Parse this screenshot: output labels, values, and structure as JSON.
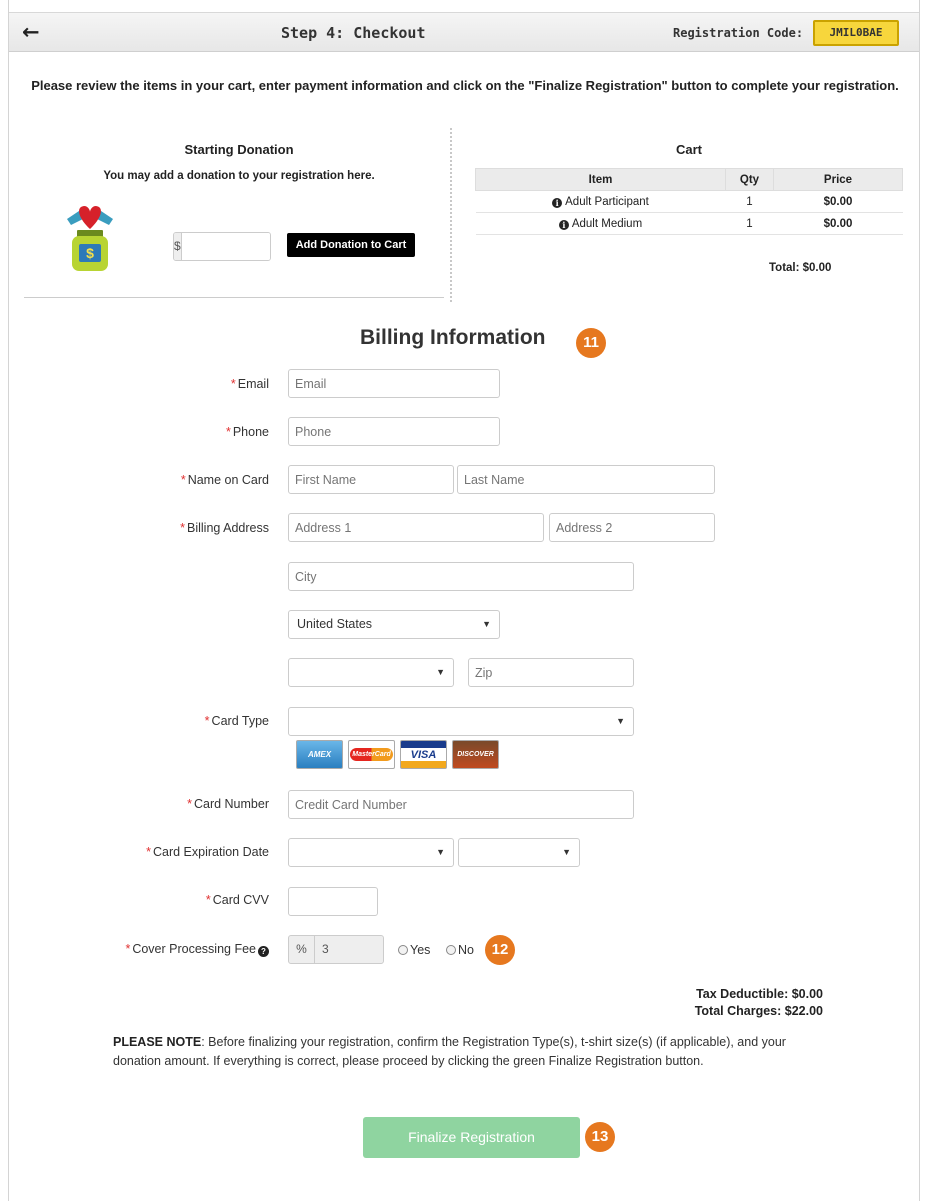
{
  "header": {
    "back_icon": "arrow-left-icon",
    "title": "Step 4: Checkout",
    "registration_code_label": "Registration Code:",
    "registration_code": "JMIL0BAE"
  },
  "intro_text": "Please review the items in your cart, enter payment information and click on the \"Finalize Registration\" button to complete your registration.",
  "donation": {
    "title": "Starting Donation",
    "subtitle": "You may add a donation to your registration here.",
    "currency_symbol": "$",
    "amount_value": "",
    "add_button_label": "Add Donation to Cart",
    "icon": "donation-jar-icon"
  },
  "cart": {
    "title": "Cart",
    "columns": [
      "Item",
      "Qty",
      "Price"
    ],
    "rows": [
      {
        "item": "Adult Participant",
        "qty": "1",
        "price": "$0.00"
      },
      {
        "item": "Adult Medium",
        "qty": "1",
        "price": "$0.00"
      }
    ],
    "total": "Total: $0.00"
  },
  "billing": {
    "title": "Billing Information",
    "required_marker": "*",
    "email": {
      "label": "Email",
      "placeholder": "Email",
      "value": ""
    },
    "phone": {
      "label": "Phone",
      "placeholder": "Phone",
      "value": ""
    },
    "name_on_card": {
      "label": "Name on Card",
      "first_placeholder": "First Name",
      "last_placeholder": "Last Name"
    },
    "billing_address": {
      "label": "Billing Address",
      "address1_placeholder": "Address 1",
      "address2_placeholder": "Address 2",
      "city_placeholder": "City",
      "country_selected": "United States",
      "state_selected": "",
      "zip_placeholder": "Zip"
    },
    "card_type": {
      "label": "Card Type",
      "selected": "",
      "card_logos": [
        "American Express",
        "MasterCard",
        "VISA",
        "DISCOVER NOVUS"
      ]
    },
    "card_number": {
      "label": "Card Number",
      "placeholder": "Credit Card Number"
    },
    "card_expiration": {
      "label": "Card Expiration Date",
      "month_selected": "",
      "year_selected": ""
    },
    "card_cvv": {
      "label": "Card CVV",
      "value": ""
    },
    "processing_fee": {
      "label": "Cover Processing Fee",
      "percent_symbol": "%",
      "percent_value": "3",
      "yes_label": "Yes",
      "no_label": "No"
    }
  },
  "totals": {
    "tax_deductible": "Tax Deductible: $0.00",
    "total_charges": "Total Charges: $22.00"
  },
  "note": {
    "bold_prefix": "PLEASE NOTE",
    "text": ": Before finalizing your registration, confirm the Registration Type(s), t-shirt size(s) (if applicable), and your donation amount. If everything is correct, please proceed by clicking the green Finalize Registration button."
  },
  "finalize_button_label": "Finalize Registration",
  "callouts": [
    "11",
    "12",
    "13"
  ],
  "colors": {
    "callout": "#e6781f",
    "finalize_button": "#8fd4a0",
    "reg_code_bg": "#f7d63c",
    "required_asterisk": "#e03030"
  }
}
